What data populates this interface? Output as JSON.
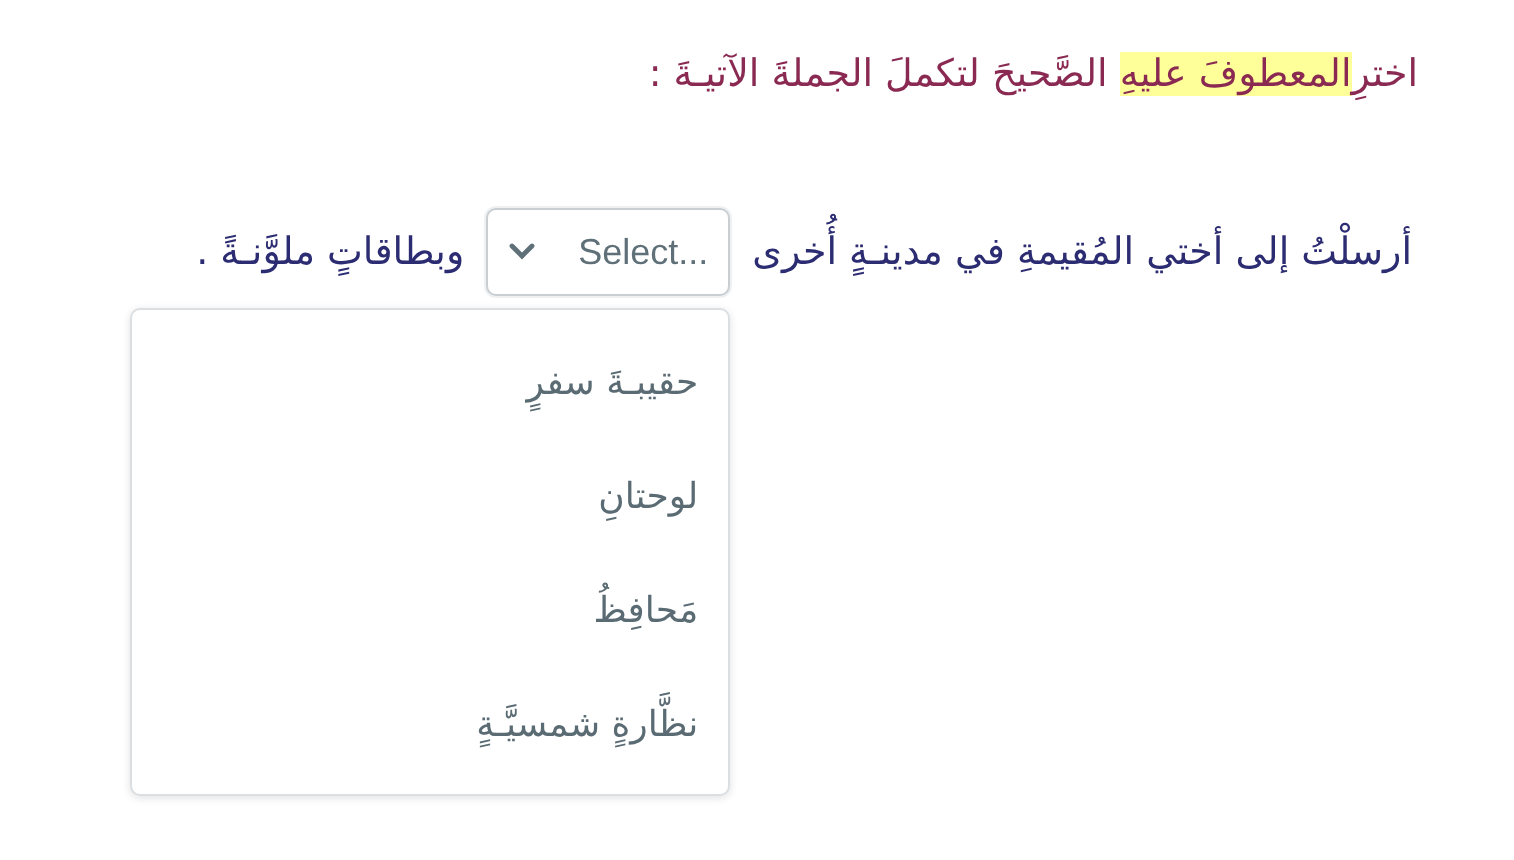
{
  "instruction": [
    {
      "text": "اخترِ",
      "highlighted": false
    },
    {
      "text": "المعطوفَ عليهِ",
      "highlighted": true
    },
    {
      "text": " الصَّحيحَ لتكملَ الجملةَ الآتيـةَ :",
      "highlighted": false
    }
  ],
  "sentence": {
    "before": "أرسلْتُ إلى أختي المُقيمةِ في مدينـةٍ أُخرى",
    "after": "وبطاقاتٍ ملوَّنـةً .",
    "select": {
      "placeholder": "Select...",
      "expanded": true,
      "options": [
        "حقيبـةَ سفرٍ",
        "لوحتانِ",
        "مَحافِظُ",
        "نظَّارةٍ شمسيَّـةٍ"
      ]
    }
  }
}
